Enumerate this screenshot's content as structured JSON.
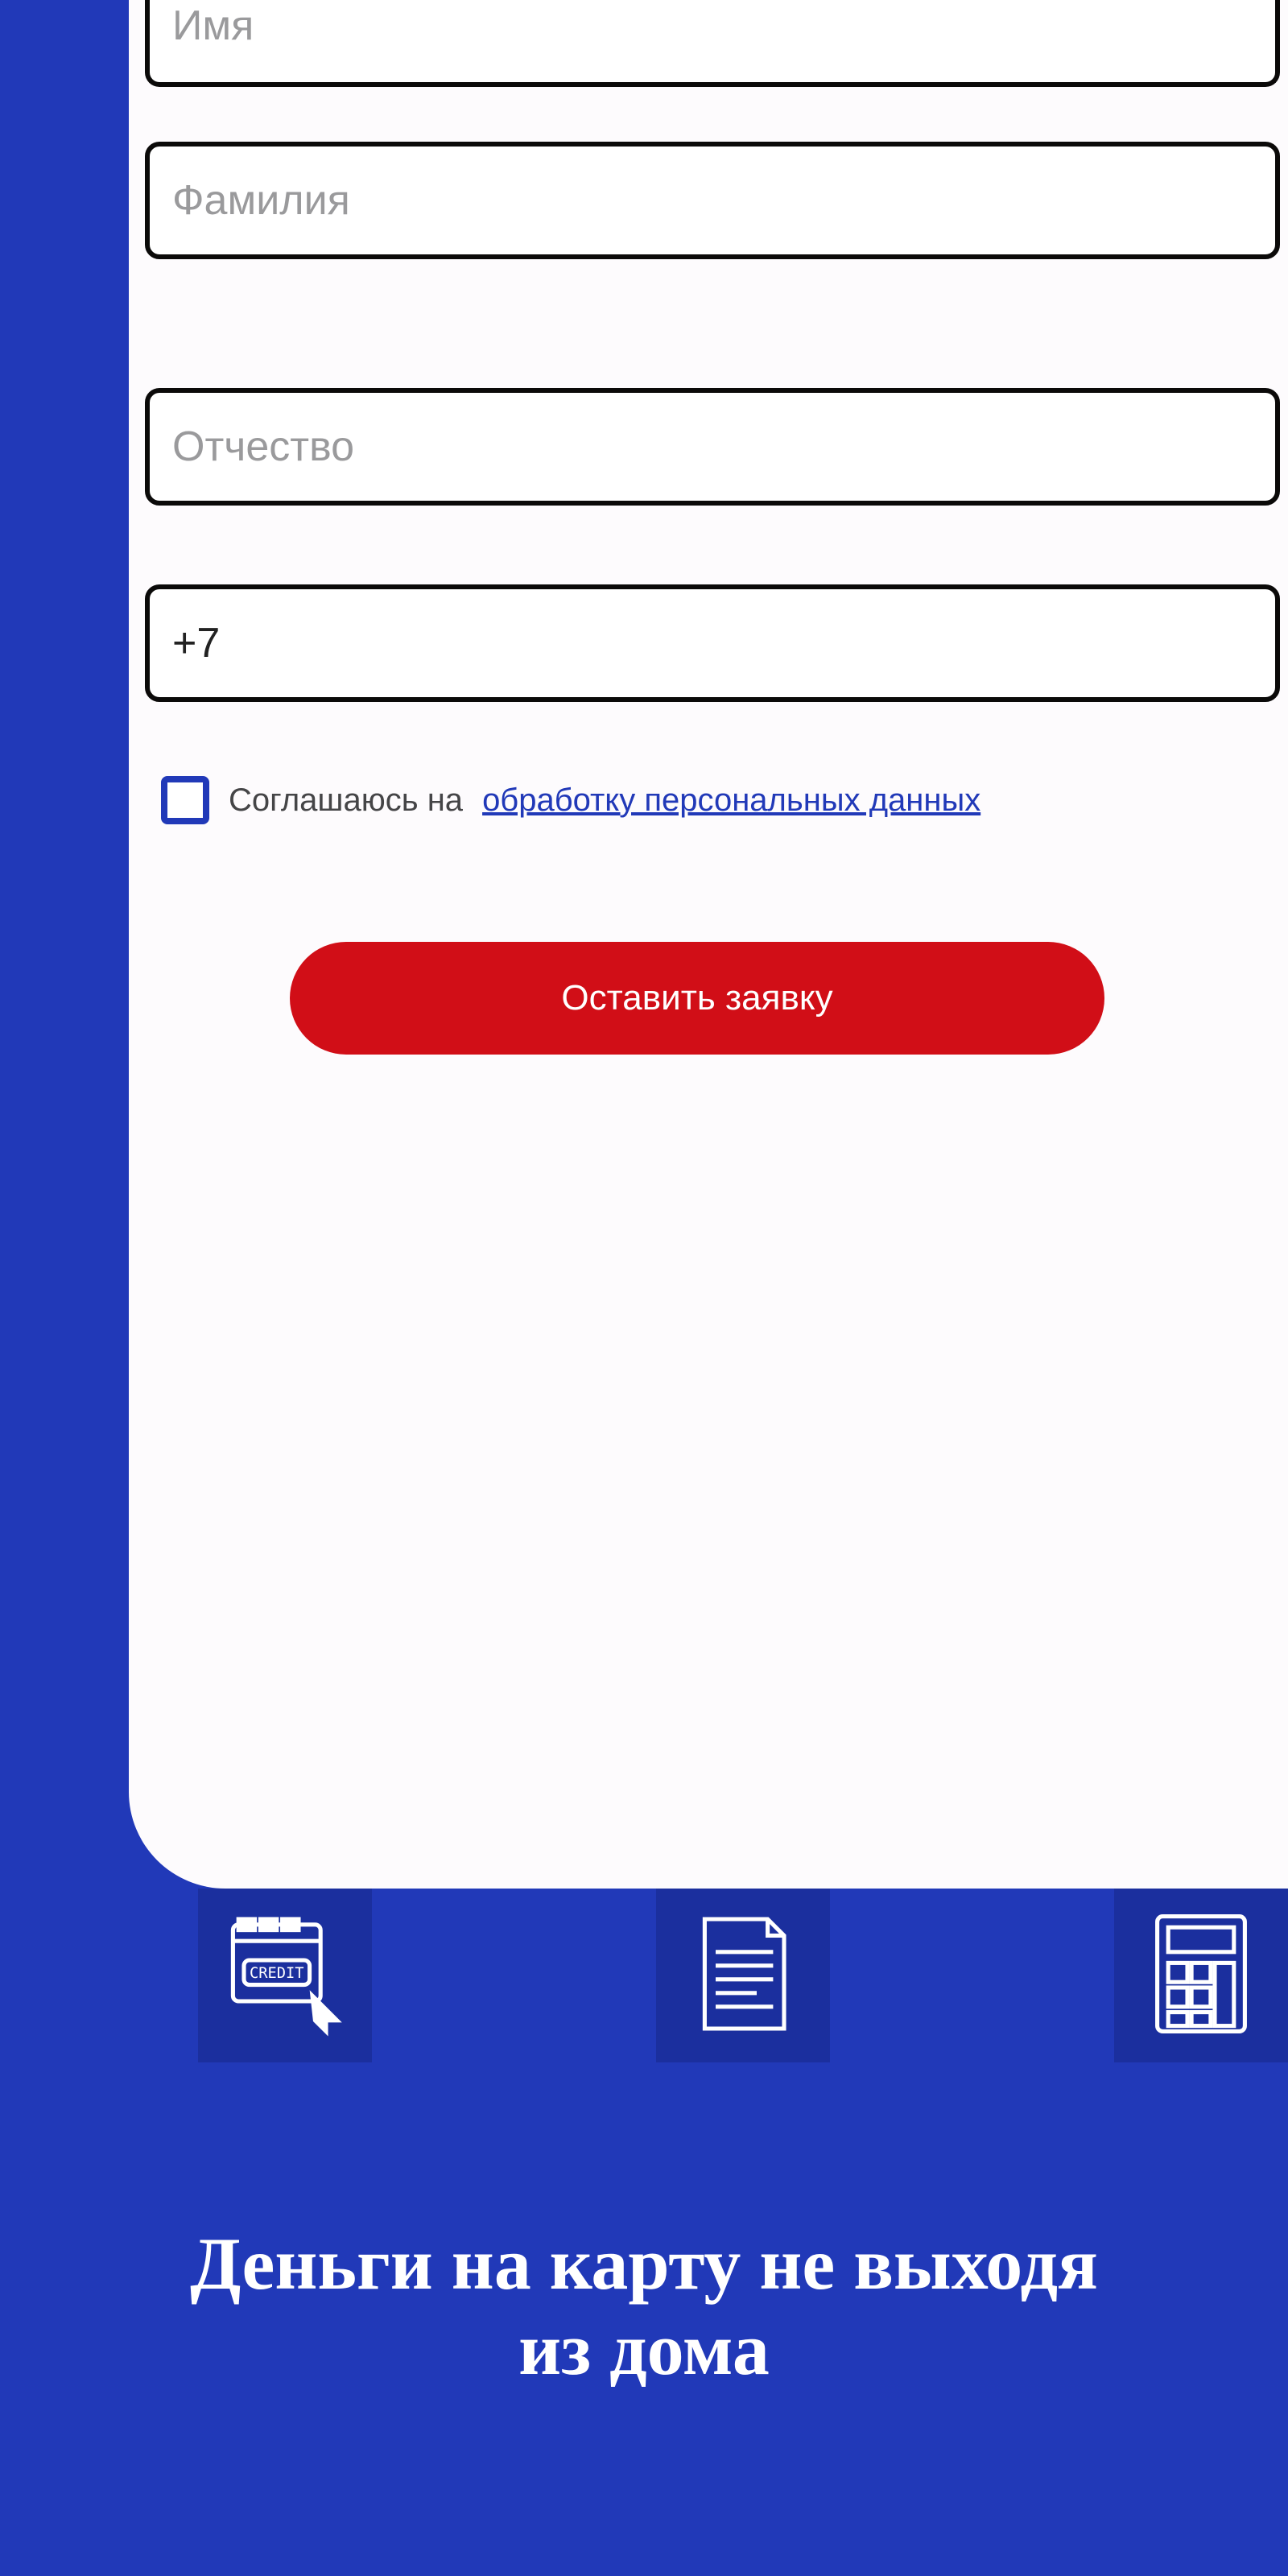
{
  "form": {
    "name_placeholder": "Имя",
    "surname_placeholder": "Фамилия",
    "patronymic_placeholder": "Отчество",
    "phone_value": "+7",
    "consent_text": "Соглашаюсь на",
    "consent_link": " обработку персональных данных",
    "submit_label": "Оставить заявку"
  },
  "nav": {
    "items": [
      "credit",
      "document",
      "calculator"
    ]
  },
  "headline": "Деньги на карту не выходя из дома"
}
